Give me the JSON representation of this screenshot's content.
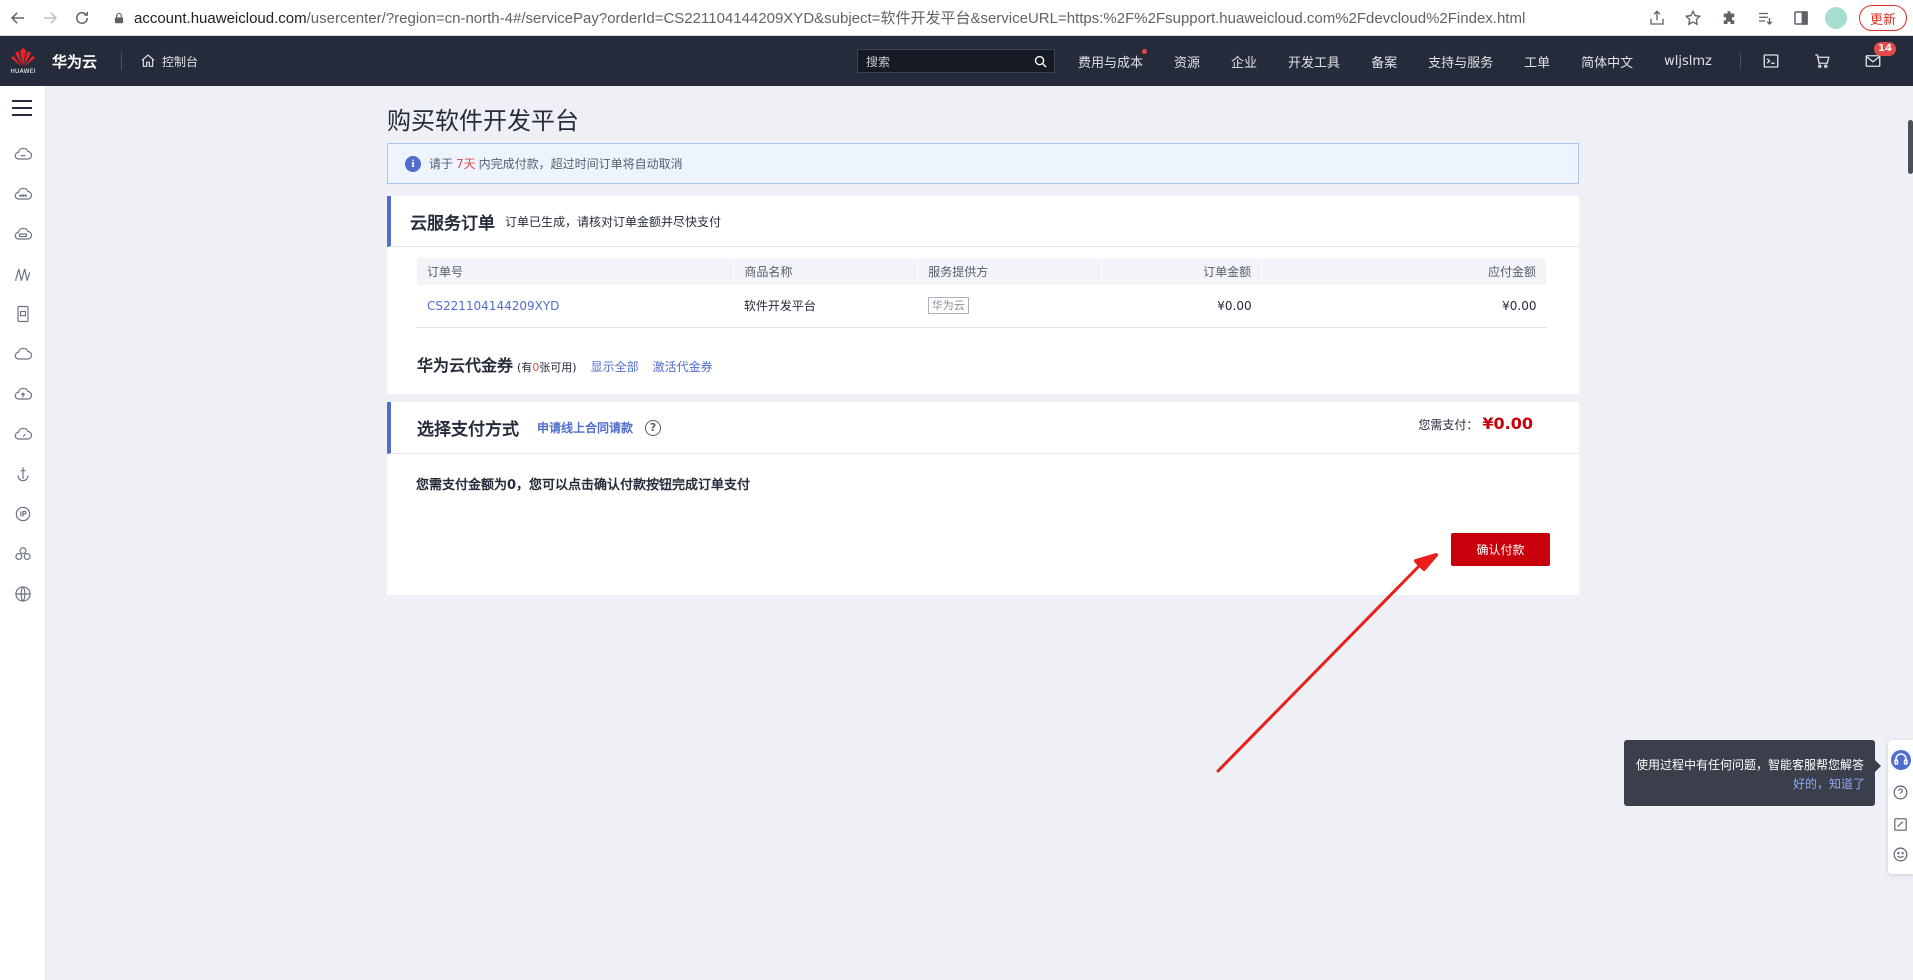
{
  "browser": {
    "url_host": "account.huaweicloud.com",
    "url_rest": "/usercenter/?region=cn-north-4#/servicePay?orderId=CS221104144209XYD&subject=软件开发平台&serviceURL=https:%2F%2Fsupport.huaweicloud.com%2Fdevcloud%2Findex.html",
    "update_label": "更新"
  },
  "header": {
    "logo_text": "HUAWEI",
    "brand": "华为云",
    "console": "控制台",
    "search_placeholder": "搜索",
    "nav": [
      "费用与成本",
      "资源",
      "企业",
      "开发工具",
      "备案",
      "支持与服务",
      "工单",
      "简体中文",
      "wljslmz"
    ],
    "notice_badge": "14"
  },
  "page": {
    "title": "购买软件开发平台",
    "notice": {
      "prefix": "请于",
      "days": "7天",
      "suffix": "内完成付款，超过时间订单将自动取消"
    }
  },
  "order_card": {
    "title": "云服务订单",
    "subtitle": "订单已生成，请核对订单金额并尽快支付",
    "columns": [
      "订单号",
      "商品名称",
      "服务提供方",
      "订单金额",
      "应付金额"
    ],
    "rows": [
      {
        "order_id": "CS221104144209XYD",
        "product": "软件开发平台",
        "provider": "华为云",
        "order_amount": "¥0.00",
        "payable_amount": "¥0.00"
      }
    ],
    "coupon": {
      "title": "华为云代金券",
      "count_prefix": "(有",
      "count": "0",
      "count_suffix": "张可用)",
      "show_all": "显示全部",
      "activate": "激活代金券"
    }
  },
  "payment_card": {
    "title": "选择支付方式",
    "apply_link": "申请线上合同请款",
    "need_pay_label": "您需支付：",
    "need_pay_amount": "¥0.00",
    "zero_message": "您需支付金额为0，您可以点击确认付款按钮完成订单支付",
    "confirm_button": "确认付款"
  },
  "tooltip": {
    "text": "使用过程中有任何问题，智能客服帮您解答",
    "action": "好的，知道了"
  },
  "colors": {
    "header_bg": "#252b3a",
    "accent_blue": "#526ecc",
    "price_red": "#c7000b",
    "annotation_arrow": "#e8201c"
  },
  "icons": {
    "sidebar": [
      "menu-icon",
      "cloud-server-icon",
      "cloud-cluster-icon",
      "cloud-disk-icon",
      "bridge-icon",
      "mobile-icon",
      "cloud-icon",
      "cloud-upload-icon",
      "cloud-speed-icon",
      "anchor-icon",
      "ip-icon",
      "cluster-icon",
      "globe-icon"
    ]
  }
}
